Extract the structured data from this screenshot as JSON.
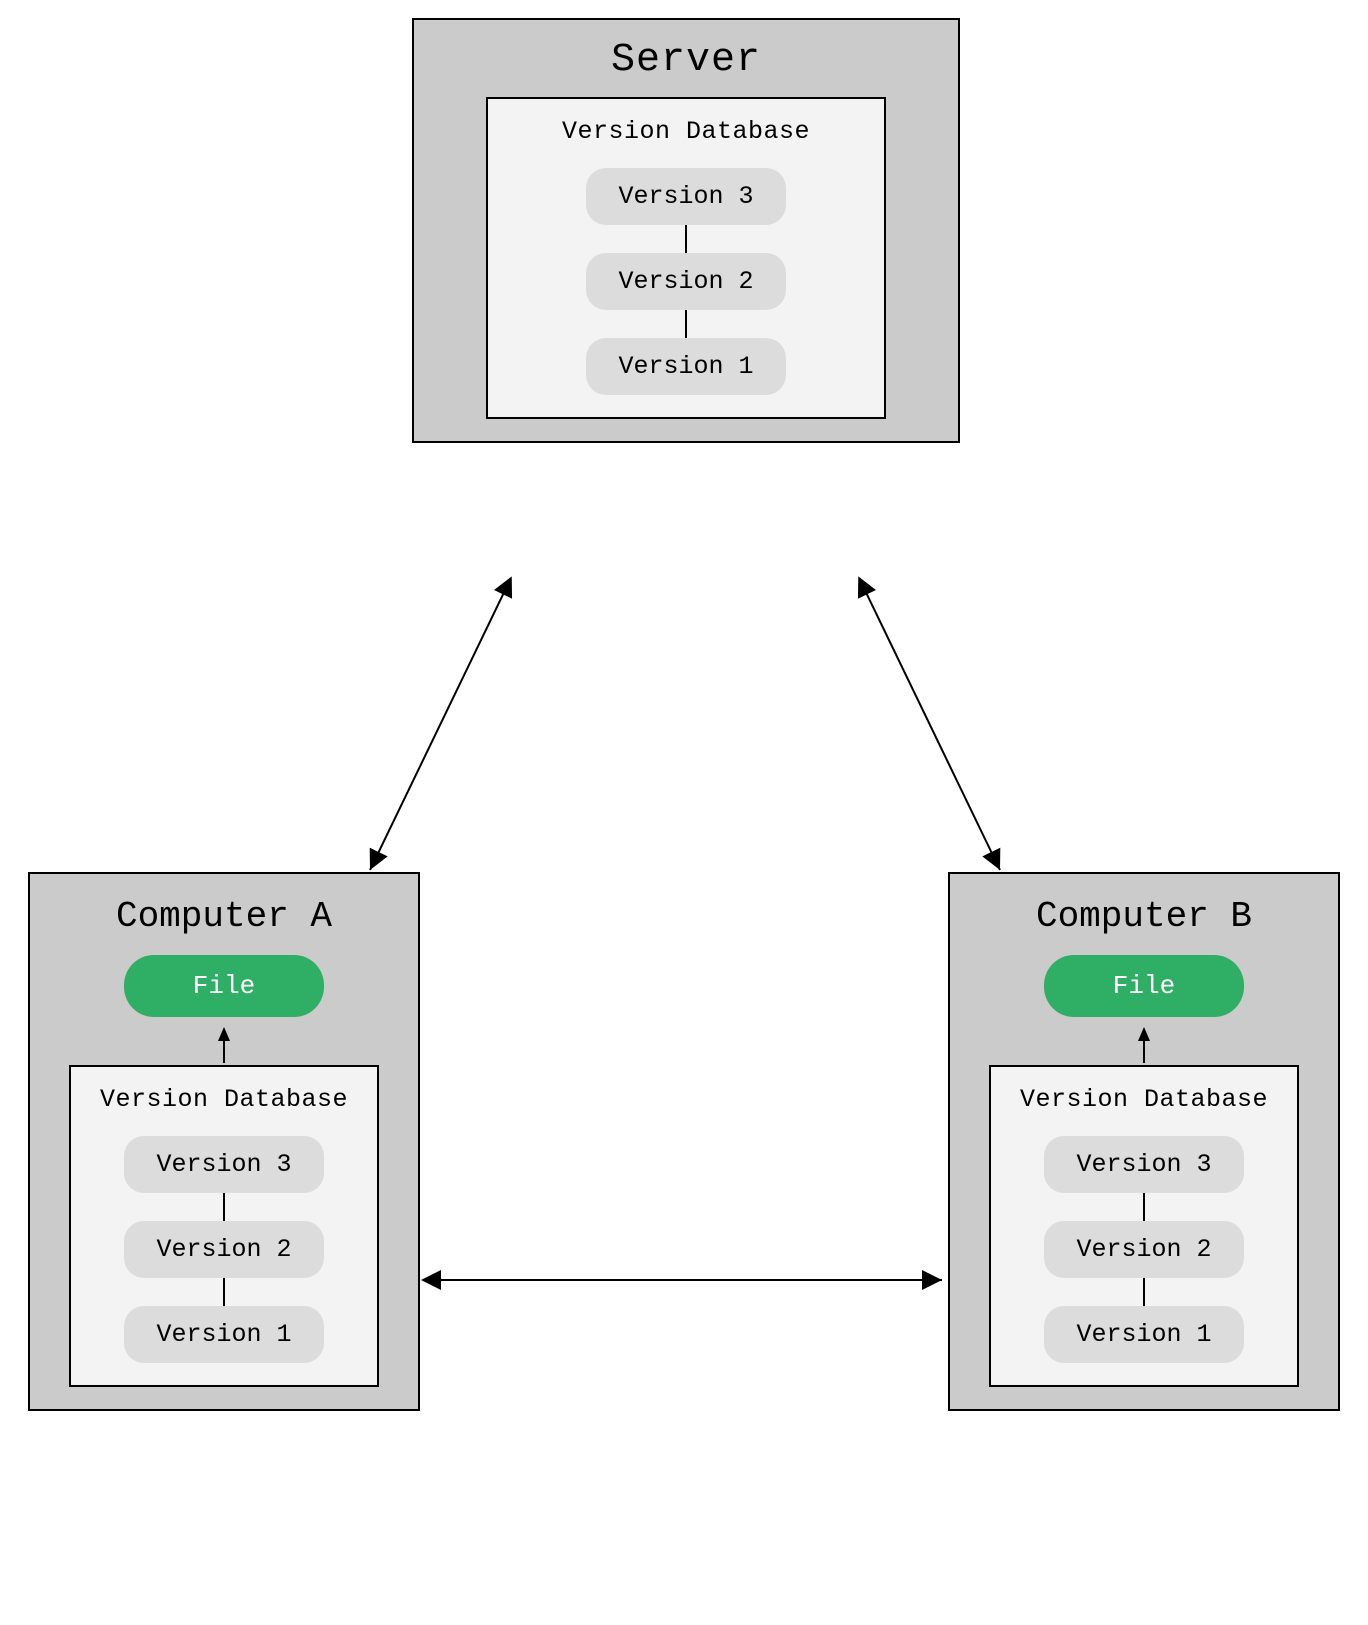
{
  "server": {
    "title": "Server",
    "database": {
      "title": "Version Database",
      "versions": [
        "Version 3",
        "Version 2",
        "Version 1"
      ]
    }
  },
  "computerA": {
    "title": "Computer A",
    "file_label": "File",
    "database": {
      "title": "Version Database",
      "versions": [
        "Version 3",
        "Version 2",
        "Version 1"
      ]
    }
  },
  "computerB": {
    "title": "Computer B",
    "file_label": "File",
    "database": {
      "title": "Version Database",
      "versions": [
        "Version 3",
        "Version 2",
        "Version 1"
      ]
    }
  },
  "connections": [
    {
      "from": "server",
      "to": "computerA",
      "bidirectional": true
    },
    {
      "from": "server",
      "to": "computerB",
      "bidirectional": true
    },
    {
      "from": "computerA",
      "to": "computerB",
      "bidirectional": true
    }
  ]
}
